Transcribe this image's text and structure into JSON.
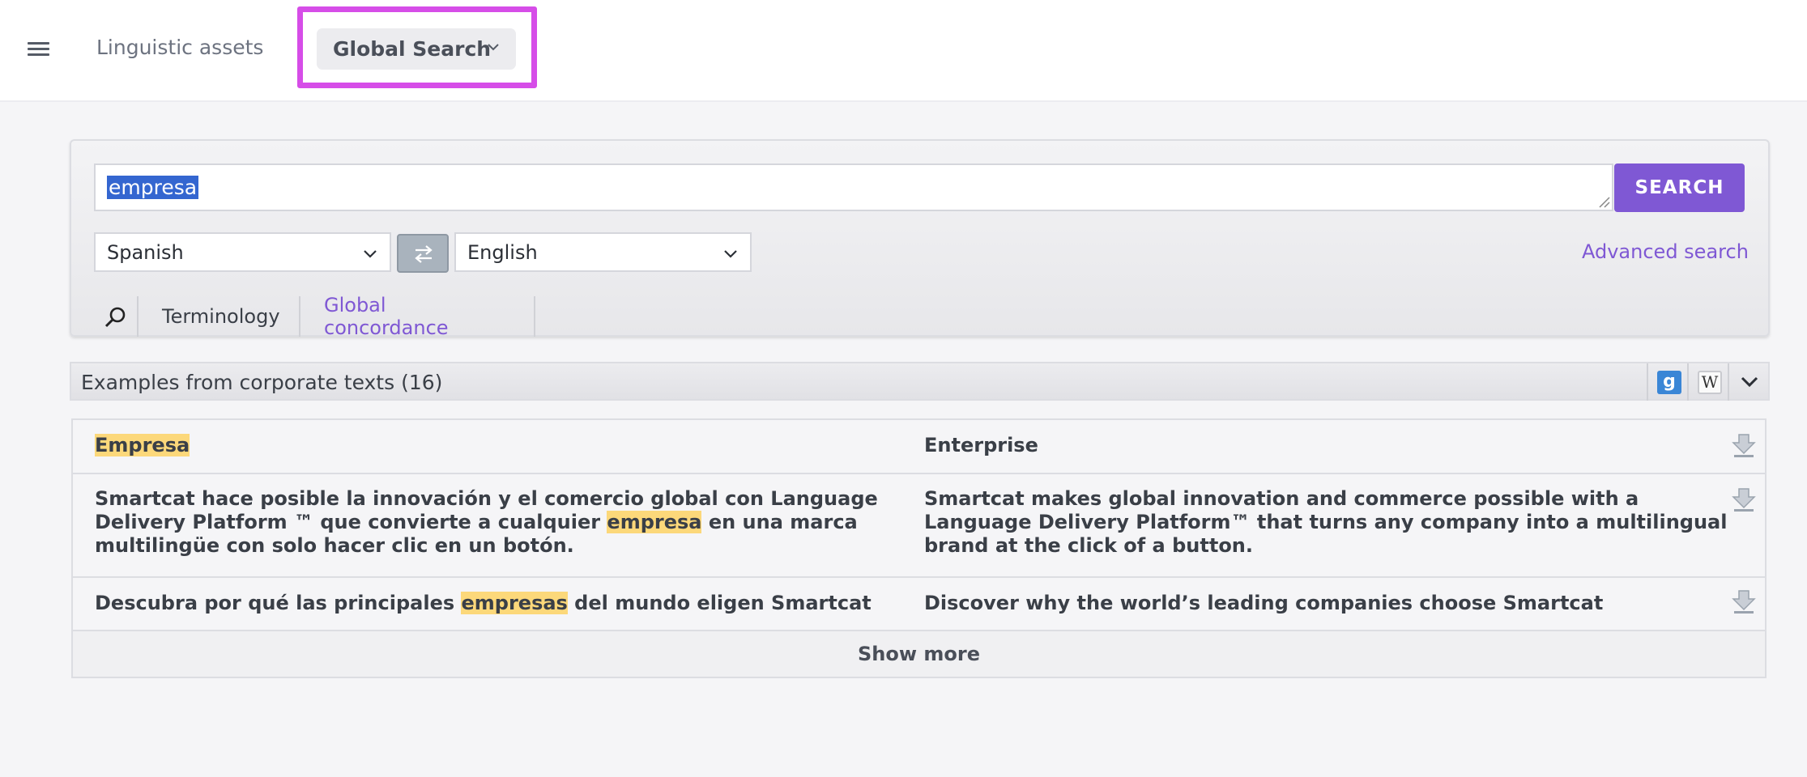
{
  "header": {
    "menu_icon": "hamburger-icon",
    "nav_link": "Linguistic assets",
    "global_search_label": "Global Search",
    "highlight_color": "#d64de8"
  },
  "search": {
    "query": "empresa",
    "button_label": "SEARCH",
    "source_language": "Spanish",
    "target_language": "English",
    "advanced_link": "Advanced search",
    "tabs": [
      {
        "label": "Terminology",
        "active": true
      },
      {
        "label": "Global concordance",
        "active": false
      }
    ]
  },
  "examples": {
    "title": "Examples from corporate texts (16)",
    "tools": [
      "google-icon",
      "wikipedia-icon",
      "collapse-chevron-icon"
    ],
    "rows": [
      {
        "source": [
          "",
          "Empresa",
          ""
        ],
        "target": "Enterprise"
      },
      {
        "source": [
          "Smartcat hace posible la innovación y el comercio global con Language Delivery Platform ™ que convierte a cualquier ",
          "empresa",
          " en una marca multilingüe con solo hacer clic en un botón."
        ],
        "target": "Smartcat makes global innovation and commerce possible with a Language Delivery Platform™ that turns any company into a multilingual brand at the click of a button."
      },
      {
        "source": [
          "Descubra por qué las principales ",
          "empresas",
          " del mundo eligen Smartcat"
        ],
        "target": "Discover why the world’s leading companies choose Smartcat"
      }
    ],
    "show_more": "Show more"
  },
  "colors": {
    "accent": "#7f58d4",
    "highlight": "#fcd87a",
    "selection": "#3466d0"
  }
}
